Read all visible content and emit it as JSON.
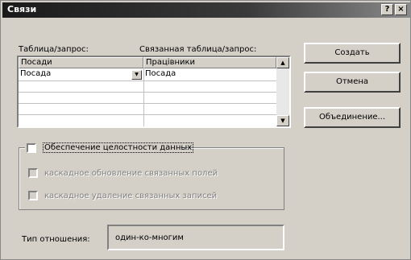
{
  "window": {
    "title": "Связи",
    "help_button": "?",
    "close_button": "×"
  },
  "labels": {
    "table_query": "Таблица/запрос:",
    "related_table_query": "Связанная таблица/запрос:"
  },
  "grid": {
    "header_left": "Посади",
    "header_right": "Працівники",
    "rows": [
      {
        "left": "Посада",
        "right": "Посада"
      }
    ]
  },
  "buttons": {
    "create": "Создать",
    "cancel": "Отмена",
    "join": "Объединение..."
  },
  "integrity": {
    "enforce": "Обеспечение целостности данных",
    "cascade_update": "каскадное обновление связанных полей",
    "cascade_delete": "каскадное удаление связанных записей"
  },
  "relationship": {
    "label": "Тип отношения:",
    "value": "один-ко-многим"
  },
  "icons": {
    "scroll_up": "▲",
    "scroll_down": "▼",
    "dropdown": "▼"
  }
}
